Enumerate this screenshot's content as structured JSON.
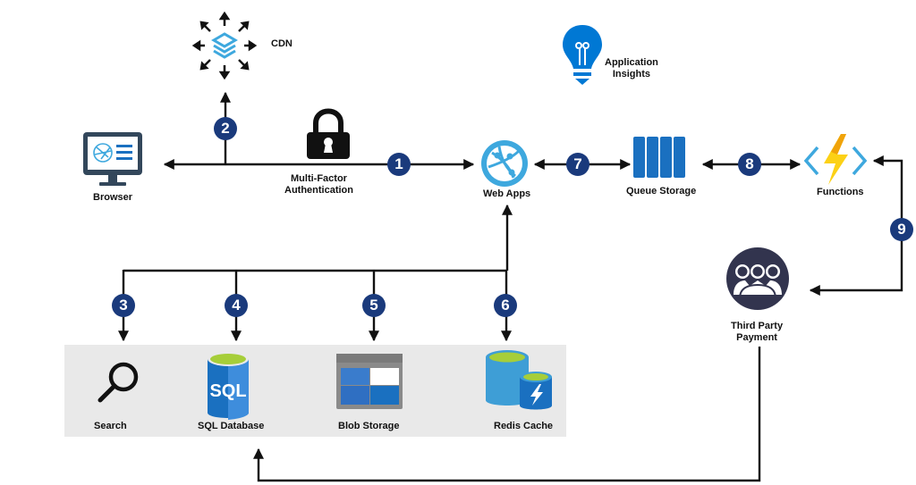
{
  "diagram": {
    "type": "azure-architecture",
    "nodes": {
      "cdn": {
        "label": "CDN"
      },
      "app_insights": {
        "label_line1": "Application",
        "label_line2": "Insights"
      },
      "browser": {
        "label": "Browser"
      },
      "mfa": {
        "label_line1": "Multi-Factor",
        "label_line2": "Authentication"
      },
      "web_apps": {
        "label": "Web Apps"
      },
      "queue_storage": {
        "label": "Queue Storage"
      },
      "functions": {
        "label": "Functions"
      },
      "third_party": {
        "label_line1": "Third Party",
        "label_line2": "Payment"
      },
      "search": {
        "label": "Search"
      },
      "sql_database": {
        "label": "SQL Database",
        "icon_text": "SQL"
      },
      "blob_storage": {
        "label": "Blob Storage"
      },
      "redis_cache": {
        "label": "Redis Cache"
      }
    },
    "steps": [
      "1",
      "2",
      "3",
      "4",
      "5",
      "6",
      "7",
      "8",
      "9"
    ],
    "edges": [
      {
        "step": "1",
        "from": "Multi-Factor Authentication",
        "to": "Web Apps"
      },
      {
        "step": "2",
        "from": "Browser",
        "to": "CDN"
      },
      {
        "step": "3",
        "from": "Web Apps",
        "to": "Search"
      },
      {
        "step": "4",
        "from": "Web Apps",
        "to": "SQL Database"
      },
      {
        "step": "5",
        "from": "Web Apps",
        "to": "Blob Storage"
      },
      {
        "step": "6",
        "from": "Web Apps",
        "to": "Redis Cache"
      },
      {
        "step": "7",
        "from": "Web Apps",
        "to": "Queue Storage",
        "bidirectional": true
      },
      {
        "step": "8",
        "from": "Queue Storage",
        "to": "Functions",
        "bidirectional": true
      },
      {
        "step": "9",
        "from": "Functions",
        "to": "Third Party Payment"
      },
      {
        "step": "",
        "from": "Third Party Payment",
        "to": "SQL Database"
      }
    ],
    "colors": {
      "badge": "#1a3a7c",
      "azure_blue": "#0078d4",
      "light_blue": "#3ea8de",
      "panel_bg": "#e9e9e9",
      "line": "#111111",
      "lightning": "#fcd116",
      "cylinder_top": "#a6ce39"
    }
  }
}
